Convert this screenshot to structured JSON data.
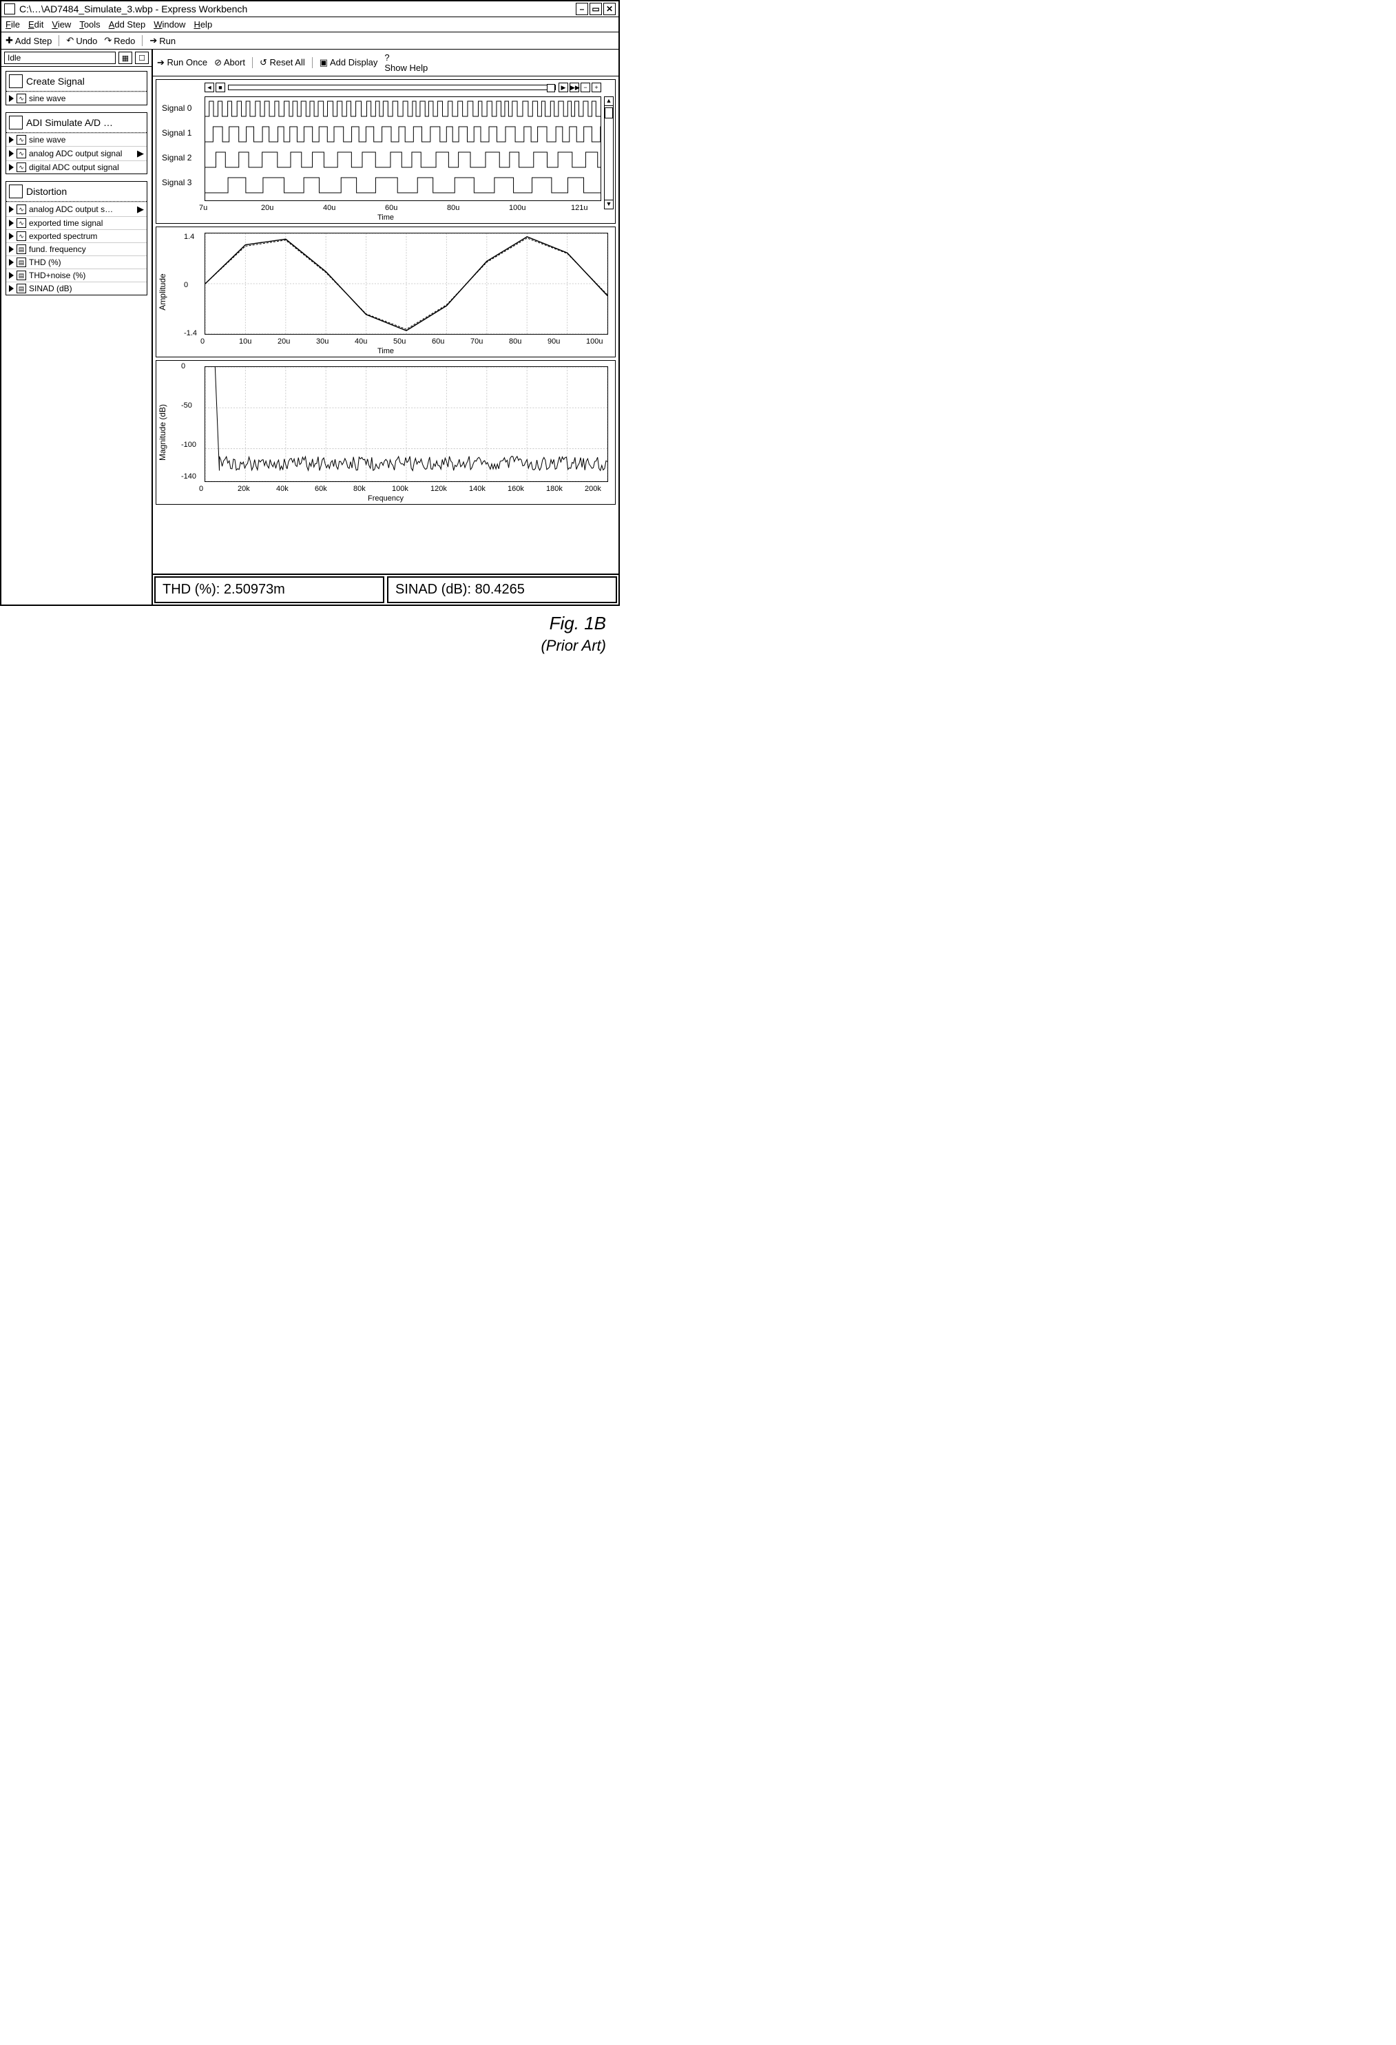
{
  "titlebar": {
    "title": "C:\\…\\AD7484_Simulate_3.wbp - Express Workbench"
  },
  "menubar": [
    "File",
    "Edit",
    "View",
    "Tools",
    "Add Step",
    "Window",
    "Help"
  ],
  "toolbar": {
    "add_step": "Add Step",
    "undo": "Undo",
    "redo": "Redo",
    "run": "Run"
  },
  "status": "Idle",
  "steps": [
    {
      "title": "Create Signal",
      "rows": [
        {
          "label": "sine wave",
          "type": "out"
        }
      ]
    },
    {
      "title": "ADI Simulate A/D …",
      "rows": [
        {
          "label": "sine wave",
          "type": "in"
        },
        {
          "label": "analog ADC output signal",
          "type": "out",
          "play": true
        },
        {
          "label": "digital ADC output signal",
          "type": "out"
        }
      ]
    },
    {
      "title": "Distortion",
      "rows": [
        {
          "label": "analog ADC output s…",
          "type": "in",
          "play": true
        },
        {
          "label": "exported time signal",
          "type": "out"
        },
        {
          "label": "exported spectrum",
          "type": "out"
        },
        {
          "label": "fund. frequency",
          "type": "scalar"
        },
        {
          "label": "THD (%)",
          "type": "scalar"
        },
        {
          "label": "THD+noise (%)",
          "type": "scalar"
        },
        {
          "label": "SINAD (dB)",
          "type": "scalar"
        }
      ]
    }
  ],
  "rtoolbar": {
    "run_once": "Run Once",
    "abort": "Abort",
    "reset_all": "Reset All",
    "add_display": "Add Display",
    "show_help": "Show Help"
  },
  "signals": [
    "Signal 0",
    "Signal 1",
    "Signal 2",
    "Signal 3"
  ],
  "results": {
    "thd_label": "THD (%): ",
    "thd_val": "2.50973m",
    "sinad_label": "SINAD (dB): ",
    "sinad_val": "80.4265"
  },
  "figure": {
    "main": "Fig. 1B",
    "sub": "(Prior Art)"
  },
  "chart_data": [
    {
      "type": "line",
      "title": "Digital signals",
      "series": [
        "Signal 0",
        "Signal 1",
        "Signal 2",
        "Signal 3"
      ],
      "x_ticks": [
        "7u",
        "20u",
        "40u",
        "60u",
        "80u",
        "100u",
        "121u"
      ],
      "xlabel": "Time"
    },
    {
      "type": "line",
      "title": "Time-domain",
      "x_ticks": [
        "0",
        "10u",
        "20u",
        "30u",
        "40u",
        "50u",
        "60u",
        "70u",
        "80u",
        "90u",
        "100u"
      ],
      "y_ticks": [
        "-1.4",
        "0",
        "1.4"
      ],
      "series": [
        {
          "name": "sine wave",
          "x": [
            0,
            10,
            20,
            30,
            40,
            50,
            60,
            70,
            80,
            90,
            100
          ],
          "y": [
            0,
            1.16,
            1.33,
            0.36,
            -0.92,
            -1.4,
            -0.66,
            0.67,
            1.4,
            0.92,
            -0.36
          ]
        },
        {
          "name": "analog ADC",
          "x": [
            0,
            10,
            20,
            30,
            40,
            50,
            60,
            70,
            80,
            90,
            100
          ],
          "y": [
            0,
            1.12,
            1.3,
            0.33,
            -0.9,
            -1.36,
            -0.63,
            0.64,
            1.36,
            0.9,
            -0.33
          ]
        }
      ],
      "xlabel": "Time",
      "ylabel": "Amplitude",
      "ylim": [
        -1.4,
        1.4
      ]
    },
    {
      "type": "line",
      "title": "Spectrum",
      "x_ticks": [
        "0",
        "20k",
        "40k",
        "60k",
        "80k",
        "100k",
        "120k",
        "140k",
        "160k",
        "180k",
        "200k"
      ],
      "y_ticks": [
        "0",
        "-50",
        "-100",
        "-140"
      ],
      "series": [
        {
          "name": "spectrum",
          "x": [
            0,
            10000,
            20000,
            200000
          ],
          "y": [
            0,
            0,
            -120,
            -125
          ]
        }
      ],
      "xlabel": "Frequency",
      "ylabel": "Magnitude (dB)",
      "ylim": [
        -140,
        0
      ]
    }
  ]
}
